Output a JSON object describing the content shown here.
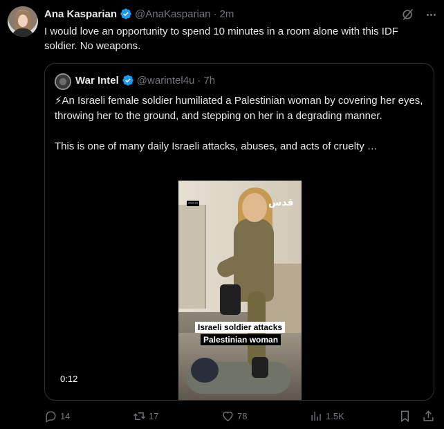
{
  "tweet": {
    "author_name": "Ana Kasparian",
    "author_handle": "@AnaKasparian",
    "separator": "·",
    "time": "2m",
    "text": "I would love an opportunity to spend 10 minutes in a room alone with this IDF soldier. No weapons."
  },
  "quoted_tweet": {
    "author_name": "War Intel",
    "author_handle": "@warintel4u",
    "separator": "·",
    "time": "7h",
    "paragraph1": "⚡An Israeli female soldier humiliated a Palestinian woman by covering her eyes, throwing her to the ground, and stepping on her in a degrading manner.",
    "paragraph2": "This is one of many daily Israeli attacks, abuses, and acts of cruelty …",
    "video": {
      "caption_line1": "Israeli soldier attacks",
      "caption_line2": "Palestinian woman",
      "watermark_right": "قدس",
      "duration": "0:12"
    }
  },
  "actions": {
    "replies": "14",
    "reposts": "17",
    "likes": "78",
    "views": "1.5K"
  },
  "icons": {
    "verified": "verified-badge-icon",
    "grok": "grok-icon",
    "more": "more-icon",
    "reply": "reply-icon",
    "repost": "repost-icon",
    "like": "like-icon",
    "views": "views-icon",
    "bookmark": "bookmark-icon",
    "share": "share-icon"
  },
  "colors": {
    "background": "#000000",
    "text": "#e7e9ea",
    "muted": "#71767b",
    "verified": "#1d9bf0",
    "border": "#2f3336"
  }
}
